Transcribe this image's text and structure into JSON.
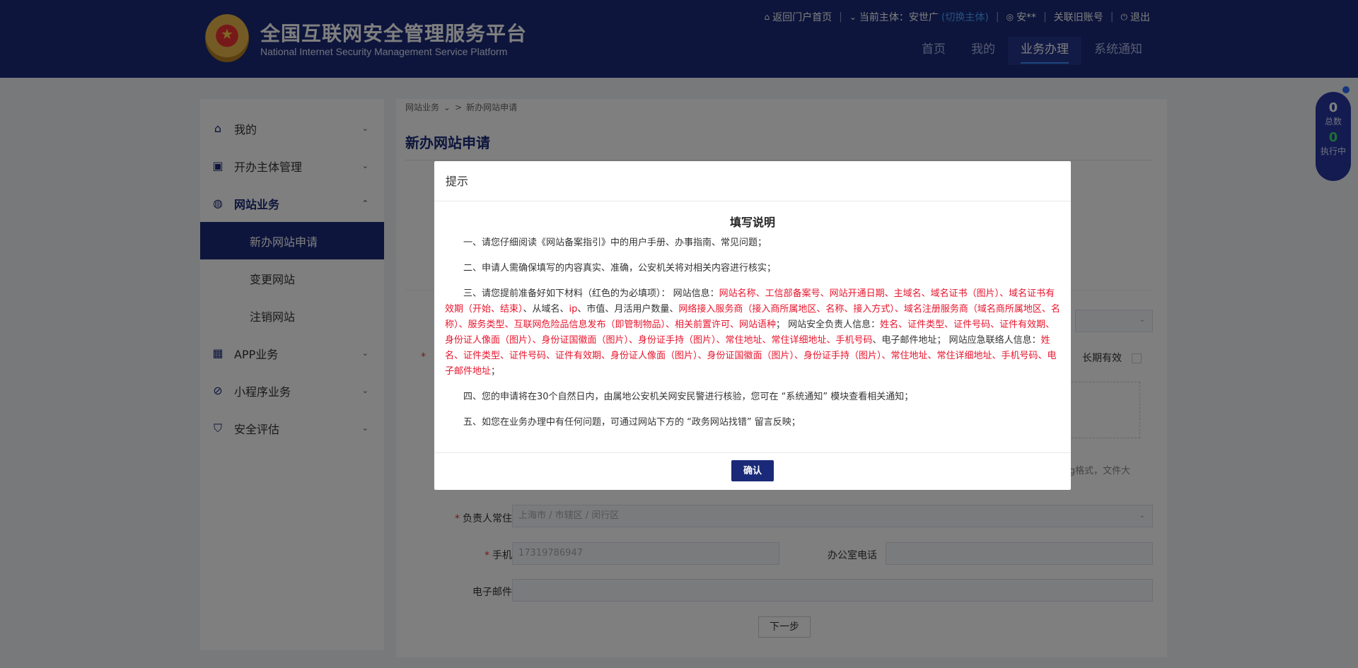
{
  "header": {
    "title": "全国互联网安全管理服务平台",
    "subtitle": "National Internet Security Management Service Platform",
    "links": {
      "home_portal": "返回门户首页",
      "current_subject_label": "当前主体：",
      "current_subject": "安世广",
      "switch_subject": "(切换主体)",
      "user": "安**",
      "link_old_account": "关联旧账号",
      "logout": "退出"
    },
    "nav": [
      "首页",
      "我的",
      "业务办理",
      "系统通知"
    ]
  },
  "sidebar": {
    "items": [
      {
        "label": "我的",
        "icon": "home-icon"
      },
      {
        "label": "开办主体管理",
        "icon": "briefcase-icon"
      },
      {
        "label": "网站业务",
        "icon": "globe-icon"
      },
      {
        "label": "APP业务",
        "icon": "grid-icon"
      },
      {
        "label": "小程序业务",
        "icon": "compass-icon"
      },
      {
        "label": "安全评估",
        "icon": "shield-icon"
      }
    ],
    "subitems": [
      "新办网站申请",
      "变更网站",
      "注销网站"
    ]
  },
  "content": {
    "breadcrumb": [
      "网站业务",
      "新办网站申请"
    ],
    "title": "新办网站申请",
    "long_valid": "长期有效",
    "upload_hint": "jpg格式，文件大",
    "fields": {
      "address_label": "负责人常住地址",
      "address_value": "上海市 / 市辖区 / 闵行区",
      "phone_label": "手机号码",
      "phone_value": "17319786947",
      "office_phone_label": "办公室电话",
      "email_label": "电子邮件地址"
    },
    "next_button": "下一步"
  },
  "counter": {
    "total_value": "0",
    "total_label": "总数",
    "running_value": "0",
    "running_label": "执行中"
  },
  "modal": {
    "header": "提示",
    "title": "填写说明",
    "p1": "一、请您仔细阅读《网站备案指引》中的用户手册、办事指南、常见问题；",
    "p2": "二、申请人需确保填写的内容真实、准确，公安机关将对相关内容进行核实；",
    "p3_a": "三、请您提前准备好如下材料（红色的为必填项）： 网站信息：",
    "p3_b": "网站名称、工信部备案号、网站开通日期、主域名、域名证书（图片）、域名证书有效期（开始、结束）",
    "p3_c": "、从域名、",
    "p3_d": "ip",
    "p3_e": "、市值、月活用户数量、",
    "p3_f": "网络接入服务商（接入商所属地区、名称、接入方式）、域名注册服务商（域名商所属地区、名称）、服务类型、互联网危险品信息发布（即管制物品）、相关前置许可、网站语种",
    "p3_g": "； 网站安全负责人信息：",
    "p3_h": "姓名、证件类型、证件号码、证件有效期、身份证人像面（图片）、身份证国徽面（图片）、身份证手持（图片）、常住地址、常住详细地址、手机号码",
    "p3_i": "、电子邮件地址； 网站应急联络人信息：",
    "p3_j": "姓名、证件类型、证件号码、证件有效期、身份证人像面（图片）、身份证国徽面（图片）、身份证手持（图片）、常住地址、常住详细地址、手机号码、电子邮件地址",
    "p3_k": "；",
    "p4": "四、您的申请将在30个自然日内，由属地公安机关网安民警进行核验，您可在 “系统通知” 模块查看相关通知；",
    "p5": "五、如您在业务办理中有任何问题，可通过网站下方的 “政务网站找错” 留言反映；",
    "confirm": "确认"
  }
}
